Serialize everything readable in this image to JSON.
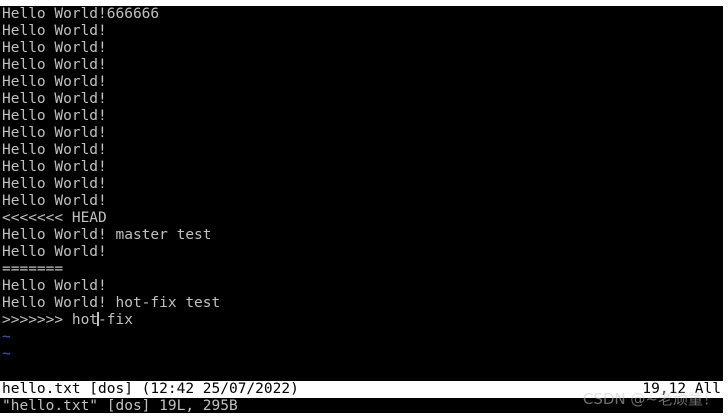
{
  "buffer": {
    "lines": [
      "Hello World!666666",
      "Hello World!",
      "Hello World!",
      "Hello World!",
      "Hello World!",
      "Hello World!",
      "Hello World!",
      "Hello World!",
      "Hello World!",
      "Hello World!",
      "Hello World!",
      "Hello World!",
      "<<<<<<< HEAD",
      "Hello World! master test",
      "Hello World!",
      "=======",
      "Hello World!",
      "Hello World! hot-fix test"
    ],
    "cursor_line": {
      "before": ">>>>>>> hot",
      "after": "-fix"
    },
    "empty_marker": "~"
  },
  "statusline": {
    "left": "hello.txt [dos] (12:42 25/07/2022)",
    "right": "19,12 All"
  },
  "cmdline": {
    "message": "\"hello.txt\" [dos] 19L, 295B"
  },
  "watermark": "CSDN @~老顽童！",
  "colors": {
    "background": "#000000",
    "text": "#c0c0c0",
    "tilde": "#3a5fcd",
    "statusline_bg": "#ffffff",
    "statusline_fg": "#000000"
  }
}
